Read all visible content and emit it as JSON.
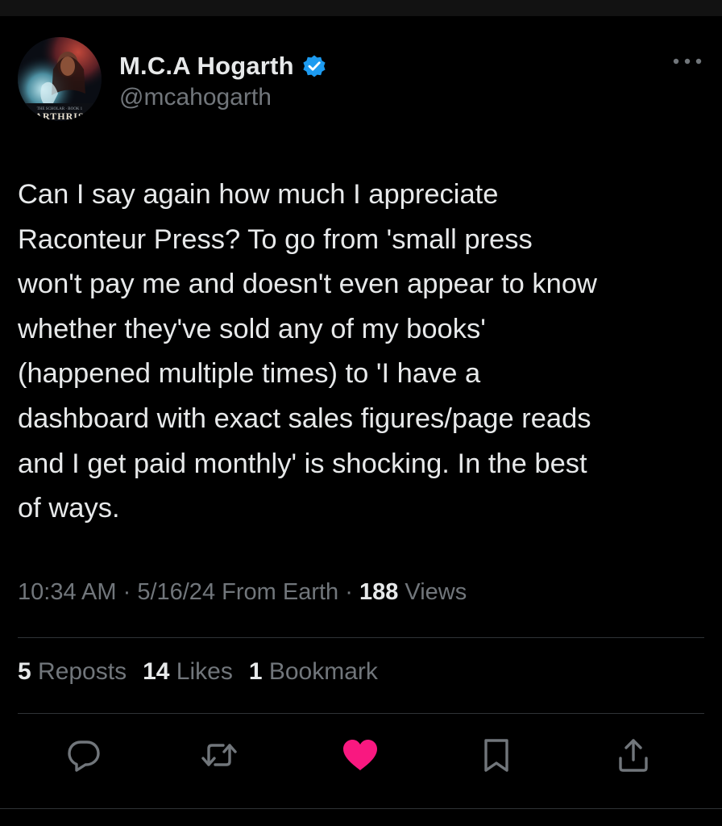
{
  "author": {
    "display_name": "M.C.A Hogarth",
    "handle": "@mcahogarth",
    "verified": true,
    "avatar_text": "ARTHRIS"
  },
  "tweet": {
    "text": "Can I say again how much I appreciate\nRaconteur Press? To go from 'small press\nwon't pay me and doesn't even appear to know\nwhether they've sold any of my books'\n(happened multiple times) to 'I have a\ndashboard with exact sales figures/page reads\nand I get paid monthly' is shocking. In the best\nof ways."
  },
  "meta": {
    "time": "10:34 AM",
    "sep1": " · ",
    "date": "5/16/24",
    "source": " From Earth",
    "sep2": " · ",
    "views_count": "188",
    "views_label": " Views"
  },
  "stats": {
    "reposts_count": "5",
    "reposts_label": " Reposts",
    "likes_count": "14",
    "likes_label": " Likes",
    "bookmarks_count": "1",
    "bookmarks_label": " Bookmark"
  },
  "actions": [
    {
      "icon": "reply-icon"
    },
    {
      "icon": "repost-icon"
    },
    {
      "icon": "heart-icon"
    },
    {
      "icon": "bookmark-icon"
    },
    {
      "icon": "share-icon"
    }
  ],
  "colors": {
    "background": "#000000",
    "text": "#e7e9ea",
    "secondary_text": "#71767b",
    "verified_blue": "#1d9bf0",
    "like_pink": "#f91880",
    "divider": "#2f3336"
  }
}
